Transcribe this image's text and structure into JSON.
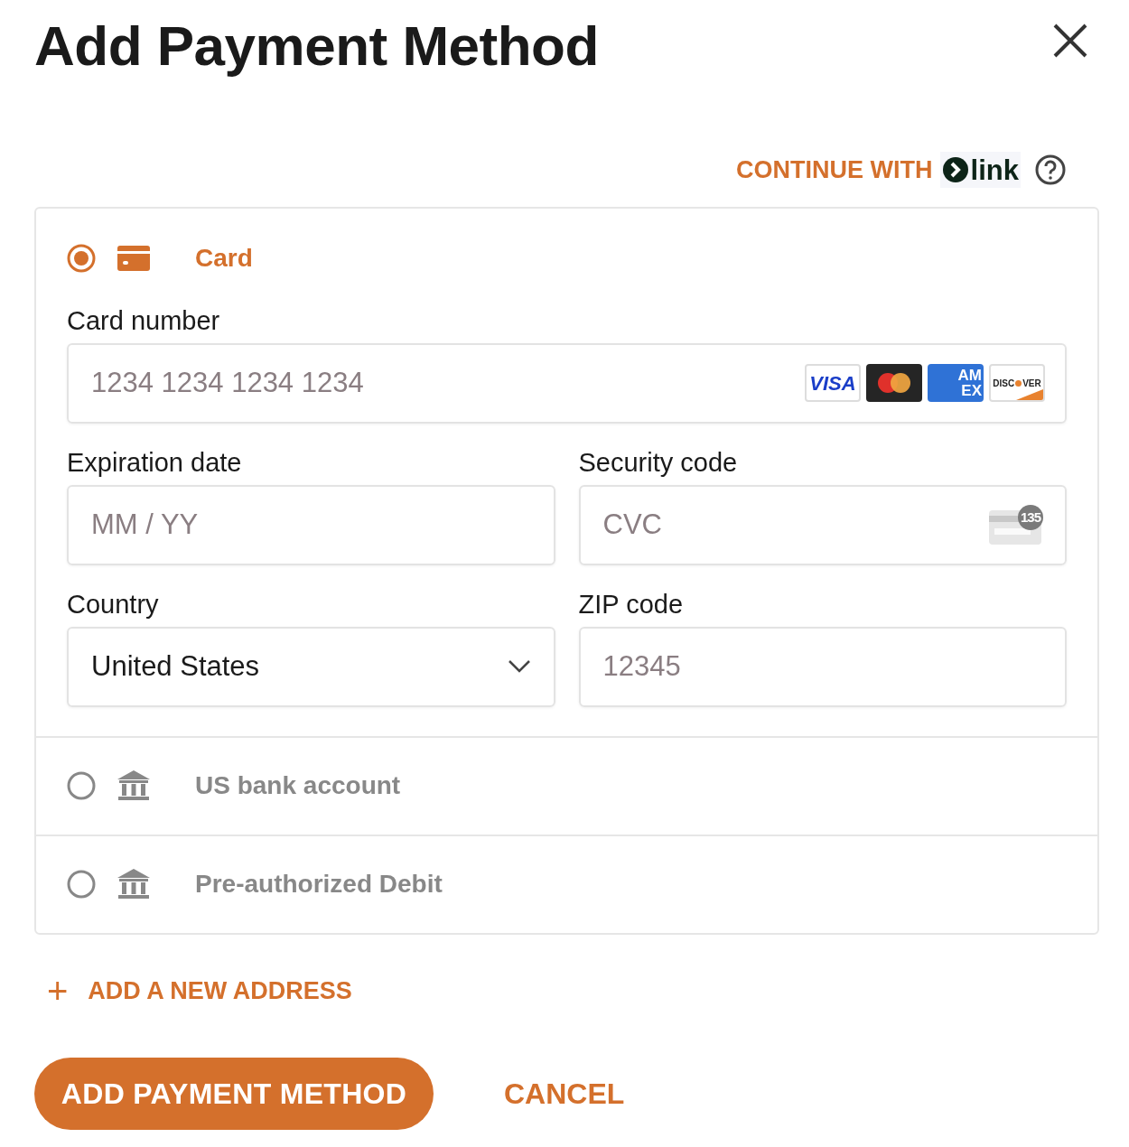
{
  "dialog": {
    "title": "Add Payment Method"
  },
  "link_prompt": {
    "label": "CONTINUE WITH",
    "brand": "link"
  },
  "payment_methods": [
    {
      "kind": "card",
      "label": "Card",
      "selected": true
    },
    {
      "kind": "bank",
      "label": "US bank account",
      "selected": false
    },
    {
      "kind": "bank",
      "label": "Pre-authorized Debit",
      "selected": false
    }
  ],
  "card_form": {
    "card_number": {
      "label": "Card number",
      "placeholder": "1234 1234 1234 1234",
      "brands": [
        {
          "kind": "visa",
          "lines": [
            "VISA"
          ]
        },
        {
          "kind": "mastercard"
        },
        {
          "kind": "amex",
          "lines": [
            "AM",
            "EX"
          ]
        },
        {
          "kind": "discover",
          "lines": [
            "DISC",
            "VER"
          ]
        }
      ]
    },
    "expiration": {
      "label": "Expiration date",
      "placeholder": "MM / YY"
    },
    "security_code": {
      "label": "Security code",
      "placeholder": "CVC",
      "hint_badge": "135"
    },
    "country": {
      "label": "Country",
      "value": "United States"
    },
    "zip": {
      "label": "ZIP code",
      "placeholder": "12345"
    }
  },
  "add_address": {
    "icon": "+",
    "label": "ADD A NEW ADDRESS"
  },
  "buttons": {
    "primary": "ADD PAYMENT METHOD",
    "secondary": "CANCEL"
  }
}
